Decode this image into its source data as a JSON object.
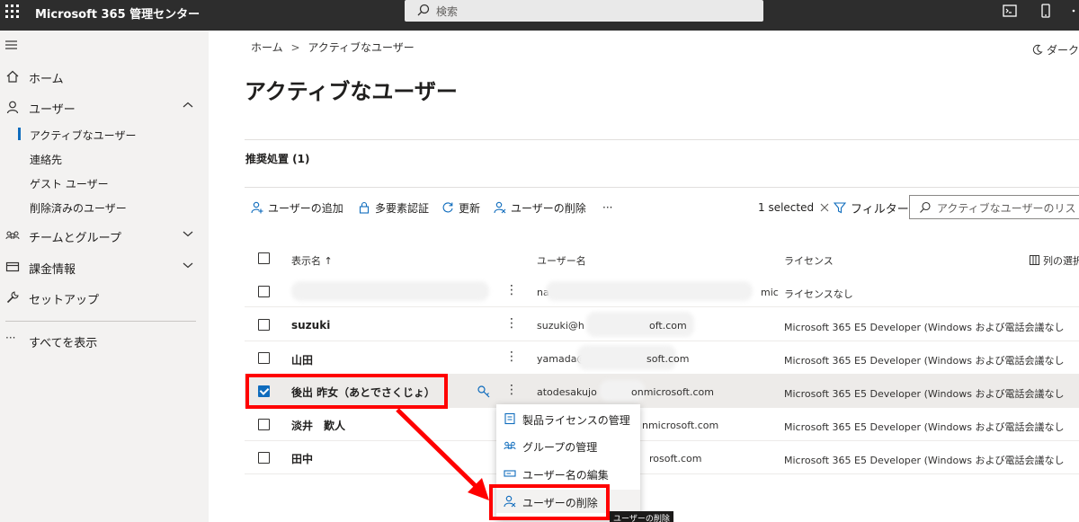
{
  "topbar": {
    "app_title": "Microsoft 365 管理センター",
    "search_placeholder": "検索"
  },
  "sidebar": {
    "items": [
      {
        "label": "ホーム",
        "icon": "home-icon"
      },
      {
        "label": "ユーザー",
        "icon": "user-icon"
      },
      {
        "label": "チームとグループ",
        "icon": "team-icon"
      },
      {
        "label": "課金情報",
        "icon": "billing-icon"
      },
      {
        "label": "セットアップ",
        "icon": "wrench-icon"
      }
    ],
    "user_subitems": [
      "アクティブなユーザー",
      "連絡先",
      "ゲスト ユーザー",
      "削除済みのユーザー"
    ],
    "show_all": "すべてを表示"
  },
  "breadcrumb": {
    "home": "ホーム",
    "sep": ">",
    "current": "アクティブなユーザー"
  },
  "dark_mode": "ダーク",
  "page_title": "アクティブなユーザー",
  "recommendations": "推奨処置 (1)",
  "commands": {
    "add_user": "ユーザーの追加",
    "mfa": "多要素認証",
    "refresh": "更新",
    "delete_user": "ユーザーの削除",
    "more": "···",
    "selected": "1 selected",
    "filter": "フィルター",
    "search_placeholder": "アクティブなユーザーのリス"
  },
  "table": {
    "headers": {
      "display_name": "表示名 ↑",
      "username": "ユーザー名",
      "license": "ライセンス",
      "columns": "列の選択"
    },
    "rows": [
      {
        "name": "",
        "user": "na",
        "user_suffix": "mic",
        "license": "ライセンスなし",
        "checked": false
      },
      {
        "name": "suzuki",
        "user": "suzuki@h",
        "user_suffix": "oft.com",
        "license": "Microsoft 365 E5 Developer (Windows および電話会議なし",
        "checked": false
      },
      {
        "name": "山田",
        "user": "yamada@",
        "user_suffix": "soft.com",
        "license": "Microsoft 365 E5 Developer (Windows および電話会議なし",
        "checked": false
      },
      {
        "name": "後出 昨女（あとでさくじょ）",
        "user": "atodesakujo",
        "user_suffix": "onmicrosoft.com",
        "license": "Microsoft 365 E5 Developer (Windows および電話会議なし",
        "checked": true
      },
      {
        "name": "淡井　歎人",
        "user": "",
        "user_suffix": "nmicrosoft.com",
        "license": "Microsoft 365 E5 Developer (Windows および電話会議なし",
        "checked": false
      },
      {
        "name": "田中",
        "user": "",
        "user_suffix": "rosoft.com",
        "license": "Microsoft 365 E5 Developer (Windows および電話会議なし",
        "checked": false
      }
    ]
  },
  "context_menu": {
    "items": [
      "製品ライセンスの管理",
      "グループの管理",
      "ユーザー名の編集",
      "ユーザーの削除"
    ]
  },
  "tooltip": "ユーザーの削除",
  "colors": {
    "accent": "#0f6cbd",
    "highlight": "#ff0000",
    "topbar": "#2d2d2d",
    "sidebar": "#f3f2f1"
  }
}
